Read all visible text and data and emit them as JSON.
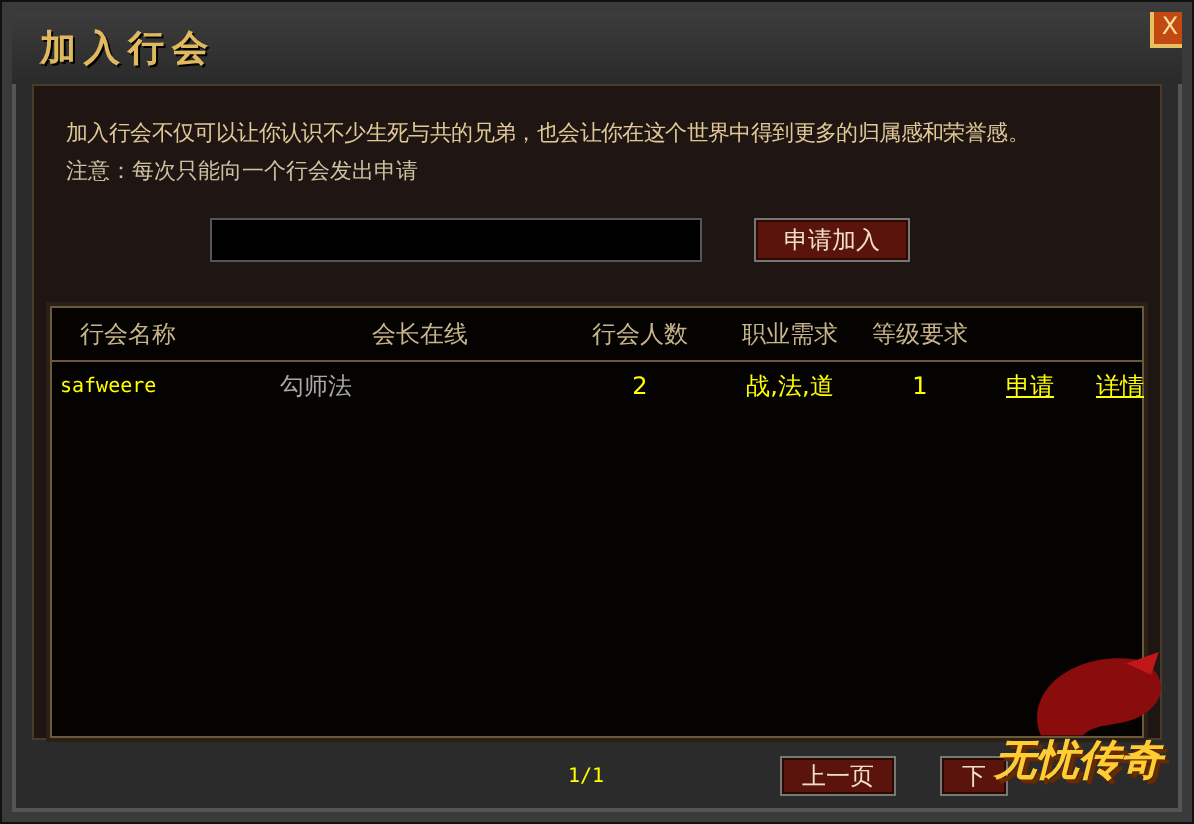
{
  "window": {
    "title": "加入行会",
    "close": "X"
  },
  "intro": {
    "text": "加入行会不仅可以让你认识不少生死与共的兄弟，也会让你在这个世界中得到更多的归属感和荣誉感。",
    "note": "注意：每次只能向一个行会发出申请"
  },
  "search": {
    "button": "申请加入"
  },
  "table": {
    "columns": [
      "行会名称",
      "会长在线",
      "行会人数",
      "职业需求",
      "等级要求"
    ],
    "rows": [
      {
        "name": "safweere",
        "leader": "勾师法",
        "members": "2",
        "classes": "战,法,道",
        "level": "1",
        "apply": "申请",
        "details": "详情"
      }
    ]
  },
  "pager": {
    "page": "1/1",
    "prev": "上一页",
    "next": "下"
  },
  "logo": {
    "text": "无忧传奇"
  }
}
